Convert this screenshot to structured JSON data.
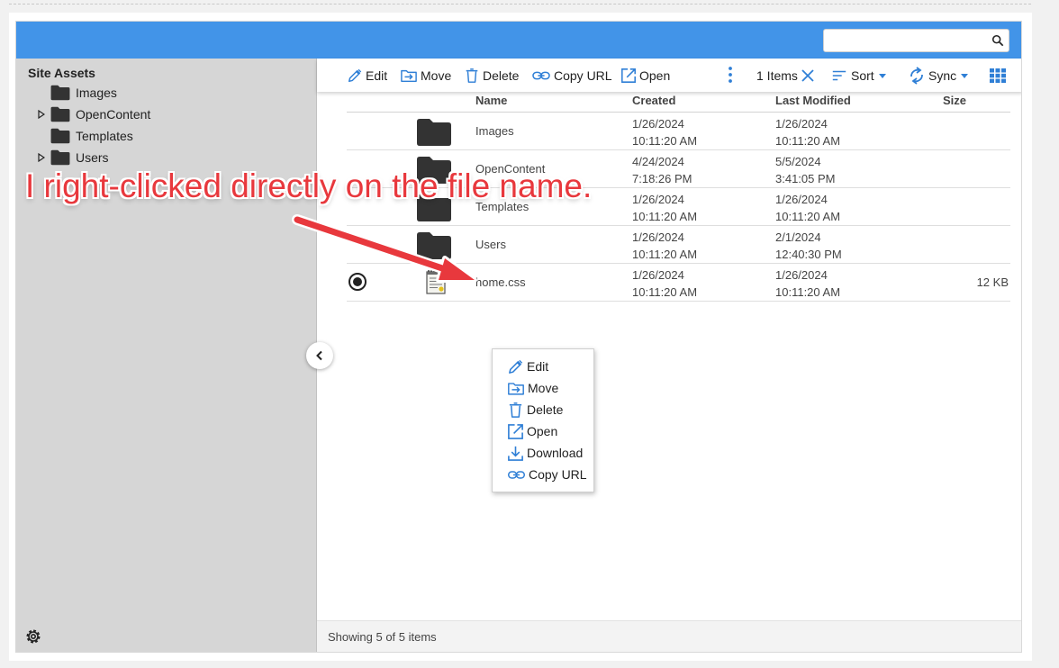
{
  "search": {
    "value": "",
    "placeholder": ""
  },
  "sidebar": {
    "title": "Site Assets",
    "items": [
      {
        "label": "Images",
        "expandable": false
      },
      {
        "label": "OpenContent",
        "expandable": true
      },
      {
        "label": "Templates",
        "expandable": false
      },
      {
        "label": "Users",
        "expandable": true
      }
    ]
  },
  "toolbar": {
    "edit": "Edit",
    "move": "Move",
    "delete": "Delete",
    "copy_url": "Copy URL",
    "open": "Open",
    "selection_count": "1 Items",
    "sort": "Sort",
    "sync": "Sync"
  },
  "grid": {
    "columns": {
      "name": "Name",
      "created": "Created",
      "modified": "Last Modified",
      "size": "Size"
    },
    "rows": [
      {
        "name": "Images",
        "created_date": "1/26/2024",
        "created_time": "10:11:20 AM",
        "modified_date": "1/26/2024",
        "modified_time": "10:11:20 AM",
        "size": "",
        "type": "folder"
      },
      {
        "name": "OpenContent",
        "created_date": "4/24/2024",
        "created_time": "7:18:26 PM",
        "modified_date": "5/5/2024",
        "modified_time": "3:41:05 PM",
        "size": "",
        "type": "folder"
      },
      {
        "name": "Templates",
        "created_date": "1/26/2024",
        "created_time": "10:11:20 AM",
        "modified_date": "1/26/2024",
        "modified_time": "10:11:20 AM",
        "size": "",
        "type": "folder"
      },
      {
        "name": "Users",
        "created_date": "1/26/2024",
        "created_time": "10:11:20 AM",
        "modified_date": "2/1/2024",
        "modified_time": "12:40:30 PM",
        "size": "",
        "type": "folder"
      },
      {
        "name": "home.css",
        "created_date": "1/26/2024",
        "created_time": "10:11:20 AM",
        "modified_date": "1/26/2024",
        "modified_time": "10:11:20 AM",
        "size": "12 KB",
        "type": "file",
        "selected": true
      }
    ]
  },
  "context_menu": {
    "items": [
      {
        "label": "Edit",
        "icon": "pencil-icon"
      },
      {
        "label": "Move",
        "icon": "move-icon"
      },
      {
        "label": "Delete",
        "icon": "trash-icon"
      },
      {
        "label": "Open",
        "icon": "open-external-icon"
      },
      {
        "label": "Download",
        "icon": "download-icon"
      },
      {
        "label": "Copy URL",
        "icon": "link-icon"
      }
    ]
  },
  "footer": {
    "status": "Showing 5 of 5 items"
  },
  "annotation": {
    "text": "I right-clicked directly on the file name."
  },
  "colors": {
    "header": "#4294e8",
    "icon_blue": "#2f7fd6",
    "annotation_red": "#e8383d",
    "sidebar_bg": "#d6d6d6"
  }
}
